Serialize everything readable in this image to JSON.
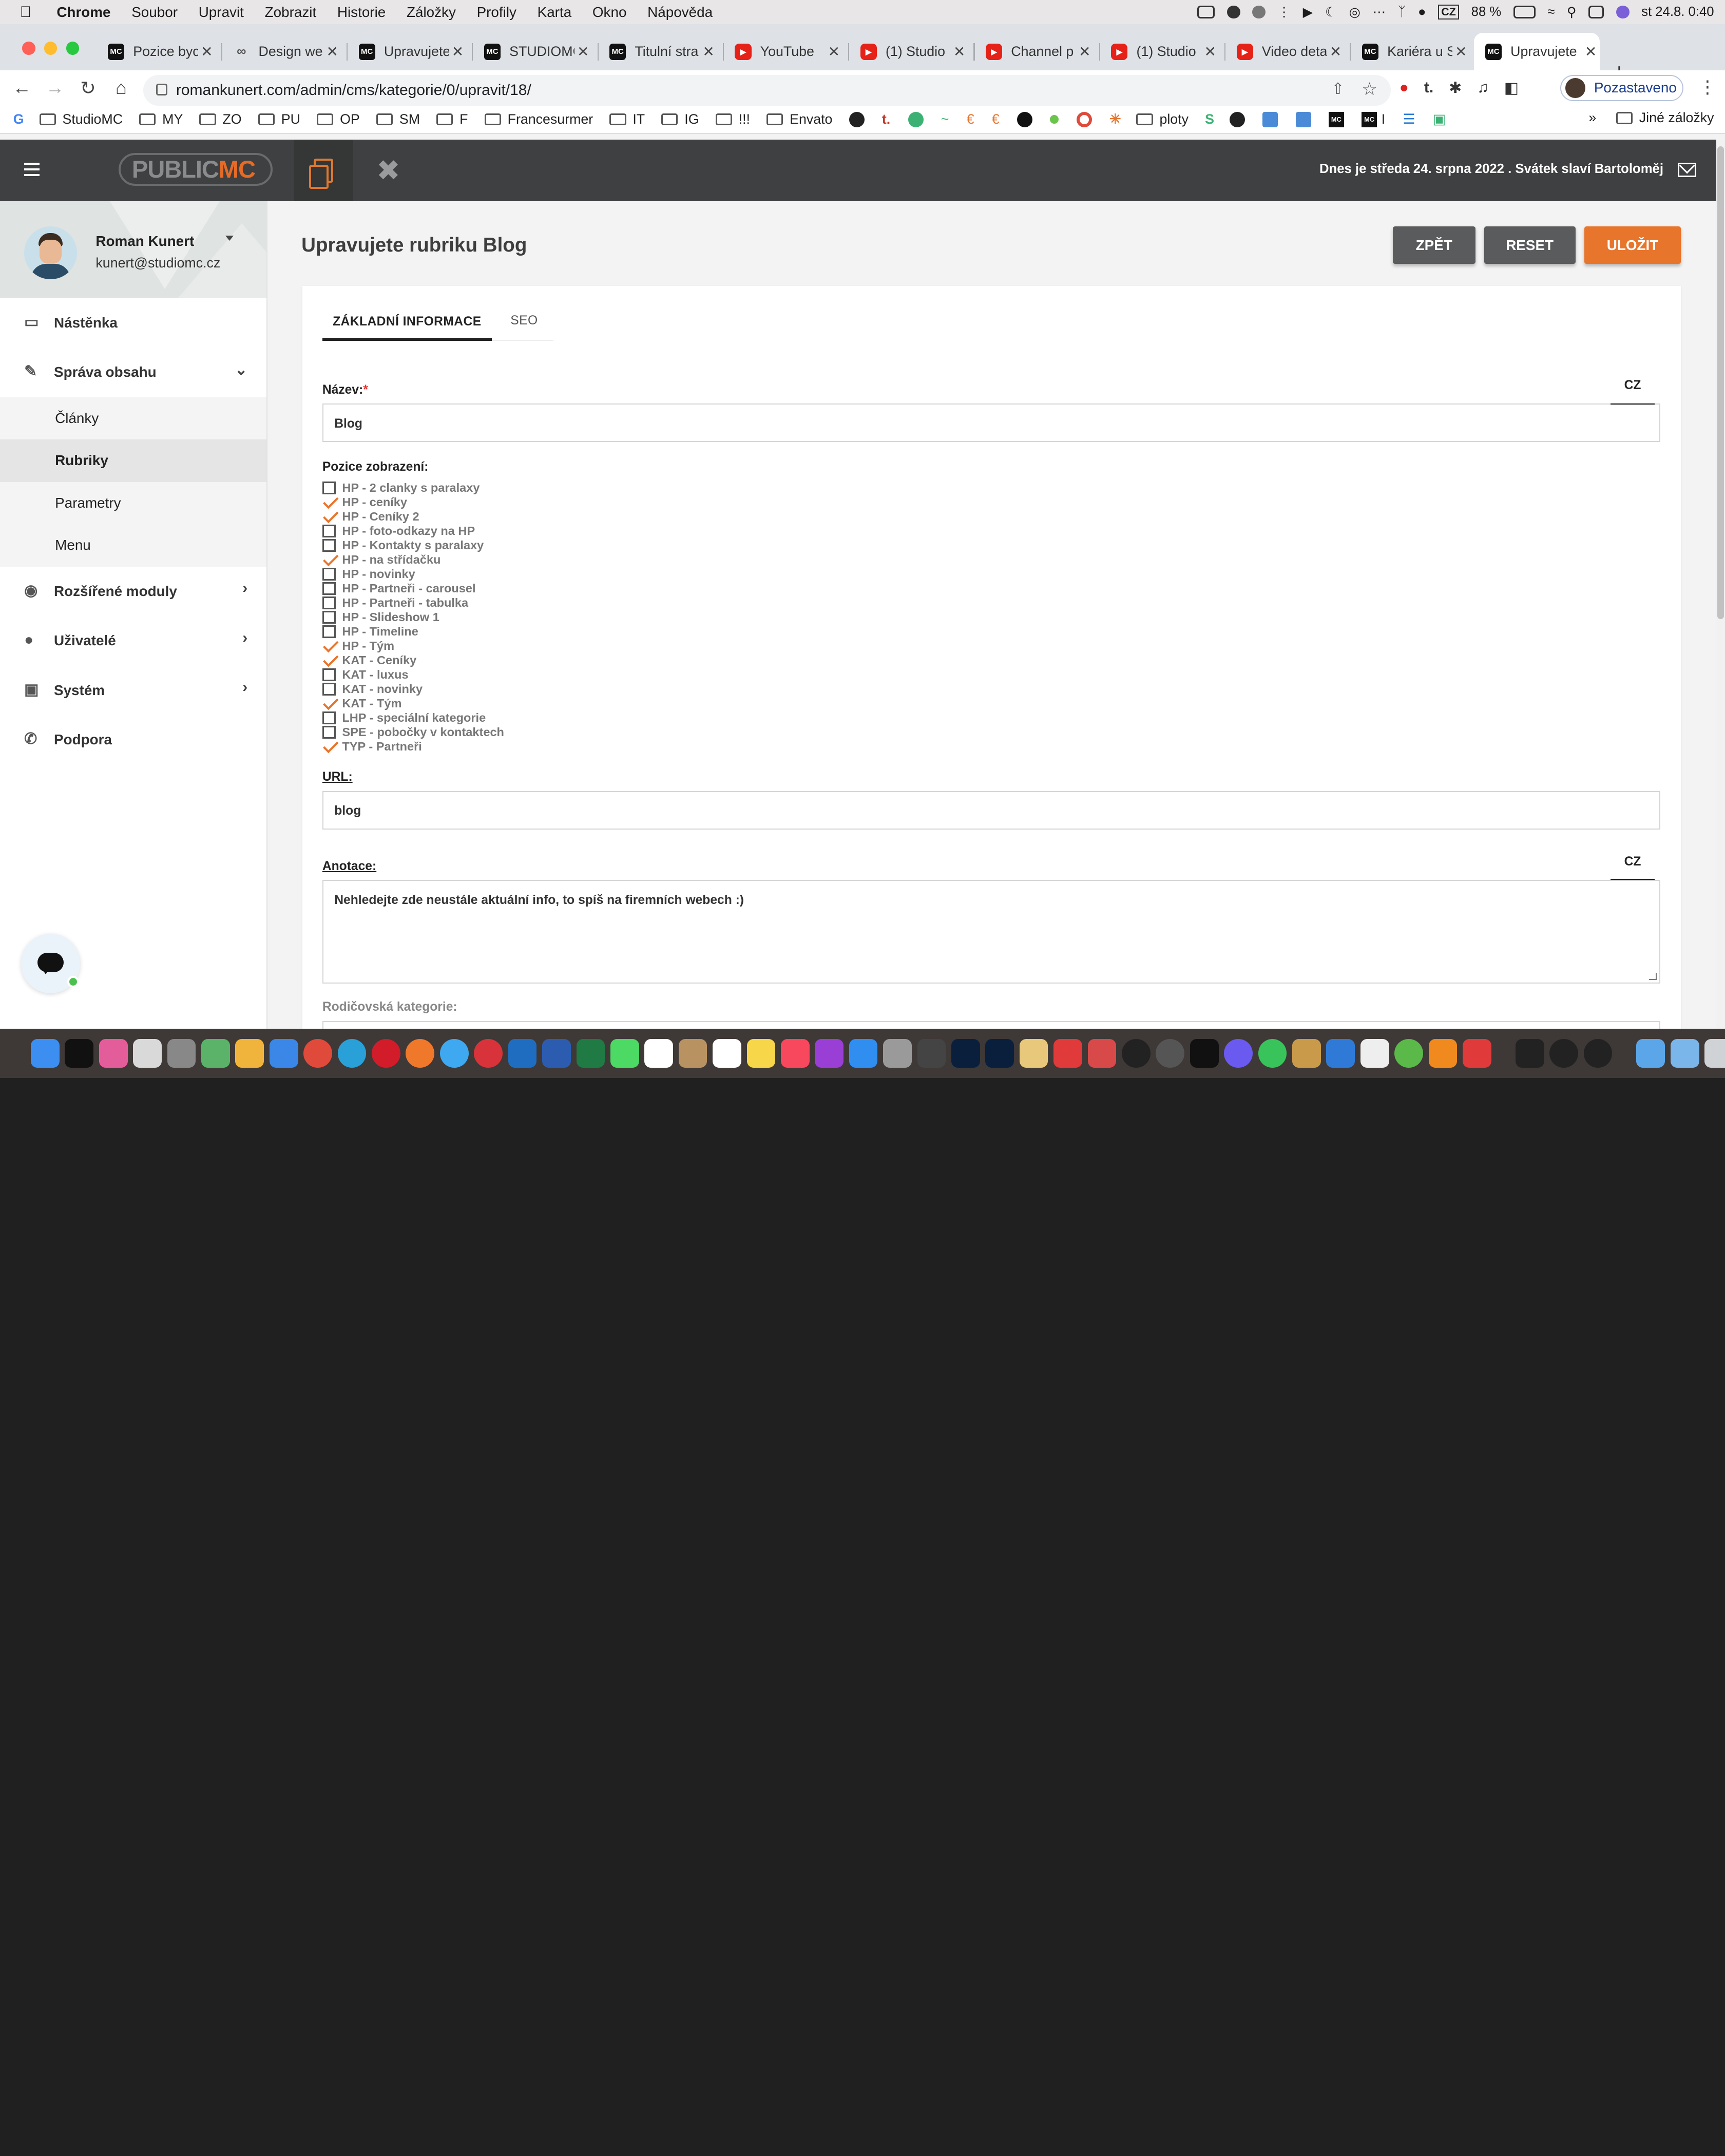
{
  "menubar": {
    "app": "Chrome",
    "items": [
      "Soubor",
      "Upravit",
      "Zobrazit",
      "Historie",
      "Záložky",
      "Profily",
      "Karta",
      "Okno",
      "Nápověda"
    ],
    "battery": "88 %",
    "input_source": "CZ",
    "clock": "st 24.8.  0:40"
  },
  "tabs": [
    {
      "title": "Pozice byc",
      "icon": "mc-icon"
    },
    {
      "title": "Design we",
      "icon": "squarespace-icon"
    },
    {
      "title": "Upravujete",
      "icon": "mc-icon"
    },
    {
      "title": "STUDIOMC",
      "icon": "mc-icon"
    },
    {
      "title": "Titulní stra",
      "icon": "mc-icon"
    },
    {
      "title": "YouTube",
      "icon": "youtube-icon"
    },
    {
      "title": "(1) Studio",
      "icon": "youtube-icon"
    },
    {
      "title": "Channel p",
      "icon": "youtube-icon"
    },
    {
      "title": "(1) Studio",
      "icon": "youtube-icon"
    },
    {
      "title": "Video deta",
      "icon": "youtube-icon"
    },
    {
      "title": "Kariéra u S",
      "icon": "mc-icon"
    },
    {
      "title": "Upravujete",
      "icon": "mc-icon",
      "active": true
    }
  ],
  "address": "romankunert.com/admin/cms/kategorie/0/upravit/18/",
  "profile_label": "Pozastaveno",
  "bookmarks": {
    "items": [
      "StudioMC",
      "MY",
      "ZO",
      "PU",
      "OP",
      "SM",
      "F",
      "Francesurmer",
      "IT",
      "IG",
      "!!!",
      "Envato"
    ],
    "trailing_folder": "ploty",
    "trailing_mc_label": "I",
    "more": "»",
    "other": "Jiné záložky"
  },
  "app_header": {
    "logo_a": "PUBLIC",
    "logo_b": "MC",
    "date_text": "Dnes je středa 24. srpna 2022 . Svátek slaví Bartoloměj"
  },
  "user": {
    "name": "Roman Kunert",
    "email": "kunert@studiomc.cz"
  },
  "sidebar": {
    "dashboard": "Nástěnka",
    "content": "Správa obsahu",
    "sub": [
      "Články",
      "Rubriky",
      "Parametry",
      "Menu"
    ],
    "modules": "Rozšířené moduly",
    "users": "Uživatelé",
    "system": "Systém",
    "support": "Podpora"
  },
  "page": {
    "title": "Upravujete rubriku Blog",
    "btn_back": "ZPĚT",
    "btn_reset": "RESET",
    "btn_save": "ULOŽIT"
  },
  "form": {
    "tab_basic": "ZÁKLADNÍ INFORMACE",
    "tab_seo": "SEO",
    "name_label": "Název:",
    "required_mark": "*",
    "lang": "CZ",
    "name_value": "Blog",
    "positions_label": "Pozice zobrazení:",
    "positions": [
      {
        "label": "HP - 2 clanky s paralaxy",
        "checked": false
      },
      {
        "label": "HP - ceníky",
        "checked": true
      },
      {
        "label": "HP - Ceníky 2",
        "checked": true
      },
      {
        "label": "HP - foto-odkazy na HP",
        "checked": false
      },
      {
        "label": "HP - Kontakty s paralaxy",
        "checked": false
      },
      {
        "label": "HP - na střídačku",
        "checked": true
      },
      {
        "label": "HP - novinky",
        "checked": false
      },
      {
        "label": "HP - Partneři - carousel",
        "checked": false
      },
      {
        "label": "HP - Partneři - tabulka",
        "checked": false
      },
      {
        "label": "HP - Slideshow 1",
        "checked": false
      },
      {
        "label": "HP - Timeline",
        "checked": false
      },
      {
        "label": "HP - Tým",
        "checked": true
      },
      {
        "label": "KAT - Ceníky",
        "checked": true
      },
      {
        "label": "KAT - luxus",
        "checked": false
      },
      {
        "label": "KAT - novinky",
        "checked": false
      },
      {
        "label": "KAT - Tým",
        "checked": true
      },
      {
        "label": "LHP - speciální kategorie",
        "checked": false
      },
      {
        "label": "SPE - pobočky v kontaktech",
        "checked": false
      },
      {
        "label": "TYP - Partneři",
        "checked": true
      }
    ],
    "url_label": "URL:",
    "url_value": "blog",
    "annotation_label": "Anotace:",
    "annotation_value": "Nehledejte zde neustále aktuální info, to spíš na firemních webech :)",
    "parent_label": "Rodičovská kategorie:"
  }
}
